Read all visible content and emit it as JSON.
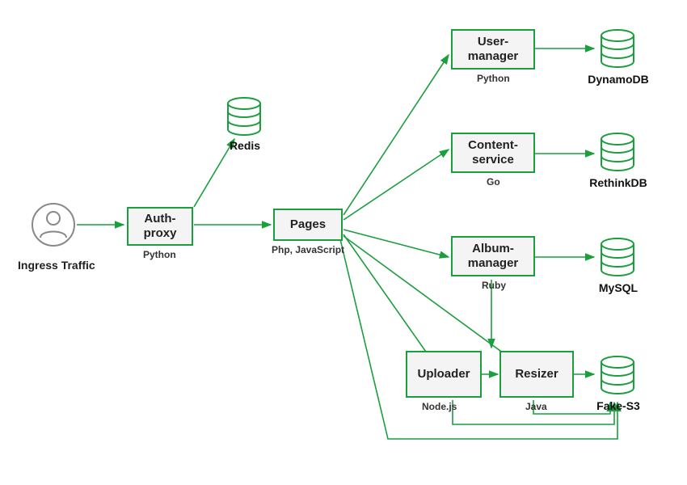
{
  "diagram": {
    "ingress_label": "Ingress Traffic",
    "nodes": {
      "auth_proxy": {
        "label": "Auth-\nproxy",
        "tech": "Python"
      },
      "pages": {
        "label": "Pages",
        "tech": "Php, JavaScript"
      },
      "user_manager": {
        "label": "User-\nmanager",
        "tech": "Python"
      },
      "content_service": {
        "label": "Content-\nservice",
        "tech": "Go"
      },
      "album_manager": {
        "label": "Album-\nmanager",
        "tech": "Ruby"
      },
      "uploader": {
        "label": "Uploader",
        "tech": "Node.js"
      },
      "resizer": {
        "label": "Resizer",
        "tech": "Java"
      }
    },
    "databases": {
      "redis": {
        "label": "Redis"
      },
      "dynamodb": {
        "label": "DynamoDB"
      },
      "rethinkdb": {
        "label": "RethinkDB"
      },
      "mysql": {
        "label": "MySQL"
      },
      "fake_s3": {
        "label": "Fake-S3"
      }
    },
    "colors": {
      "stroke": "#1a9e3e",
      "user_stroke": "#888888"
    },
    "connections": [
      {
        "from": "user",
        "to": "auth_proxy"
      },
      {
        "from": "auth_proxy",
        "to": "redis"
      },
      {
        "from": "auth_proxy",
        "to": "pages"
      },
      {
        "from": "pages",
        "to": "user_manager"
      },
      {
        "from": "pages",
        "to": "content_service"
      },
      {
        "from": "pages",
        "to": "album_manager"
      },
      {
        "from": "pages",
        "to": "uploader"
      },
      {
        "from": "pages",
        "to": "resizer"
      },
      {
        "from": "user_manager",
        "to": "dynamodb"
      },
      {
        "from": "content_service",
        "to": "rethinkdb"
      },
      {
        "from": "album_manager",
        "to": "mysql"
      },
      {
        "from": "album_manager",
        "to": "uploader"
      },
      {
        "from": "uploader",
        "to": "resizer"
      },
      {
        "from": "resizer",
        "to": "fake_s3"
      },
      {
        "from": "uploader",
        "to": "fake_s3"
      },
      {
        "from": "pages",
        "to": "fake_s3"
      }
    ]
  }
}
